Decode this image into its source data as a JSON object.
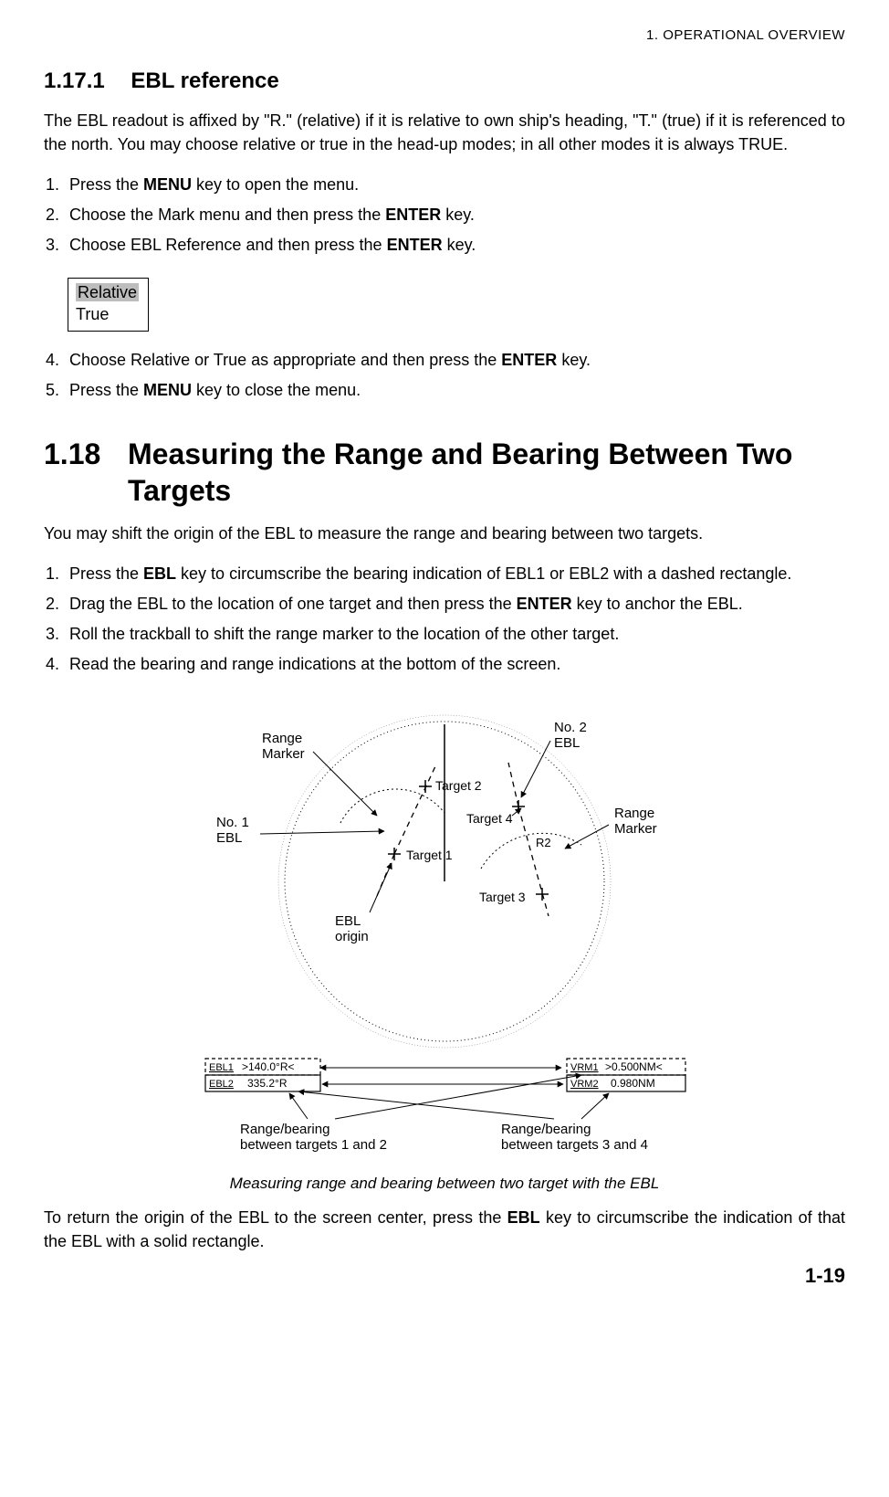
{
  "running_head": "1. OPERATIONAL OVERVIEW",
  "sec_1_17_1": {
    "num": "1.17.1",
    "title": "EBL reference",
    "para": "The EBL readout is affixed by \"R.\" (relative) if it is relative to own ship's heading, \"T.\" (true) if it is referenced to the north. You may choose relative or true in the head-up modes; in all other modes it is always TRUE.",
    "steps": [
      {
        "pre": "Press the ",
        "b": "MENU",
        "post": " key to open the menu."
      },
      {
        "pre": "Choose the Mark menu and then press the ",
        "b": "ENTER",
        "post": " key."
      },
      {
        "pre": "Choose EBL Reference and then press the ",
        "b": "ENTER",
        "post": " key."
      }
    ],
    "options": {
      "selected": "Relative",
      "other": "True"
    },
    "steps2": [
      {
        "pre": "Choose Relative or True as appropriate and then press the ",
        "b": "ENTER",
        "post": " key."
      },
      {
        "pre": "Press the ",
        "b": "MENU",
        "post": " key to close the menu."
      }
    ]
  },
  "sec_1_18": {
    "num": "1.18",
    "title": "Measuring the Range and Bearing Between Two Targets",
    "intro": "You may shift the origin of the EBL to measure the range and bearing between two targets.",
    "steps": [
      {
        "pre": "Press the ",
        "b": "EBL",
        "post": " key to circumscribe the bearing indication of EBL1 or EBL2 with a dashed rectangle."
      },
      {
        "pre": "Drag the EBL to the location of one target and then press the ",
        "b": "ENTER",
        "post": " key to anchor the EBL."
      },
      {
        "pre": "Roll the trackball to shift the range marker to the location of the other target.",
        "b": "",
        "post": ""
      },
      {
        "pre": "Read the bearing and range indications at the bottom of the screen.",
        "b": "",
        "post": ""
      }
    ],
    "figure": {
      "labels": {
        "range_marker_l": "Range\nMarker",
        "no1_ebl": "No. 1\nEBL",
        "ebl_origin": "EBL\norigin",
        "target1": "Target 1",
        "target2": "Target 2",
        "target3": "Target 3",
        "target4": "Target 4",
        "no2_ebl": "No. 2\nEBL",
        "range_marker_r": "Range\nMarker",
        "r2": "R2",
        "ebl1_lbl": "EBL1",
        "ebl1_val": ">140.0°R<",
        "ebl2_lbl": "EBL2",
        "ebl2_val": "335.2°R",
        "vrm1_lbl": "VRM1",
        "vrm1_val": ">0.500NM<",
        "vrm2_lbl": "VRM2",
        "vrm2_val": "0.980NM",
        "caption_l": "Range/bearing\nbetween targets 1 and 2",
        "caption_r": "Range/bearing\nbetween targets 3 and 4"
      },
      "caption": "Measuring range and bearing between two target with the EBL"
    },
    "outro_pre": "To return the origin of the EBL to the screen center, press the ",
    "outro_b": "EBL",
    "outro_post": " key to circumscribe the indication of that the EBL with a solid rectangle."
  },
  "page_number": "1-19"
}
